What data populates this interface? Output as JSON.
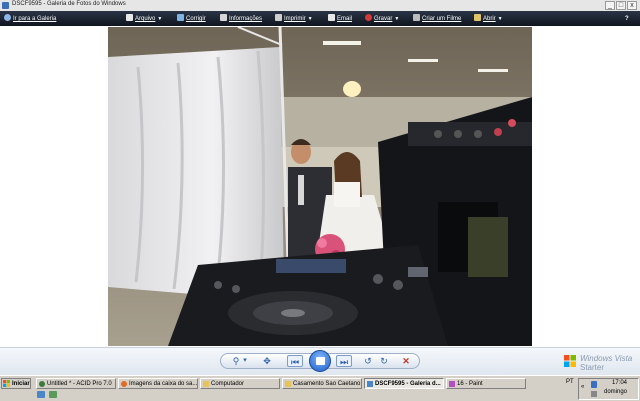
{
  "window": {
    "title": "DSCF9595 - Galeria de Fotos do Windows",
    "controls": {
      "minimize": "_",
      "maximize": "□",
      "close": "x"
    }
  },
  "commandbar": {
    "back": "Ir para a Galeria",
    "items": [
      {
        "label": "Arquivo",
        "icon": "file-icon",
        "has_menu": true
      },
      {
        "label": "Corrigir",
        "icon": "fix-icon",
        "has_menu": false
      },
      {
        "label": "Informações",
        "icon": "info-icon",
        "has_menu": false
      },
      {
        "label": "Imprimir",
        "icon": "print-icon",
        "has_menu": true
      },
      {
        "label": "Email",
        "icon": "email-icon",
        "has_menu": false
      },
      {
        "label": "Gravar",
        "icon": "burn-icon",
        "has_menu": true
      },
      {
        "label": "Criar um Filme",
        "icon": "movie-icon",
        "has_menu": false
      },
      {
        "label": "Abrir",
        "icon": "open-icon",
        "has_menu": true
      }
    ],
    "menu_arrow": "▼"
  },
  "controlbar": {
    "zoom": "⚲",
    "zoom_arrow": "▾",
    "fit": "✥",
    "previous": "⏮",
    "next": "⏭",
    "rotate_left": "↺",
    "rotate_right": "↻",
    "delete": "✕"
  },
  "branding": {
    "line1": "Windows Vista",
    "line2": "Starter"
  },
  "taskbar": {
    "start": "Iniciar",
    "tasks": [
      {
        "label": "Untitled * - ACID Pro 7.0",
        "icon": "acid-icon",
        "active": false
      },
      {
        "label": "Imagens da caixa do sa...",
        "icon": "firefox-icon",
        "active": false
      },
      {
        "label": "Computador",
        "icon": "folder-icon",
        "active": false
      },
      {
        "label": "Casamento Sao Caetano",
        "icon": "folder-icon",
        "active": false
      },
      {
        "label": "DSCF9595 - Galeria d...",
        "icon": "gallery-icon",
        "active": true
      },
      {
        "label": "16 - Paint",
        "icon": "paint-icon",
        "active": false
      }
    ],
    "language": "PT",
    "time": "17:04",
    "day": "domingo"
  },
  "colors": {
    "commandbar_bg": "#1b2433",
    "accent": "#2d5ea8",
    "close": "#c0392b"
  }
}
